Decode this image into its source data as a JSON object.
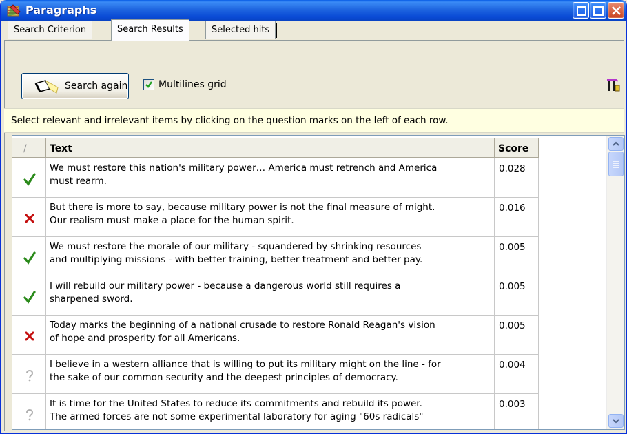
{
  "window": {
    "title": "Paragraphs",
    "icon": "paragraphs-app-icon",
    "controls": [
      "minimize-icon",
      "maximize-icon",
      "close-icon"
    ],
    "title_bar_color": "#0a4bd6"
  },
  "tabs": [
    {
      "label": "Search Criterion",
      "active": false
    },
    {
      "label": "Search Results",
      "active": true
    },
    {
      "label": "Selected hits",
      "active": false
    }
  ],
  "toolbar": {
    "search_again_label": "Search again",
    "search_icon": "flashlight-icon",
    "multilines_label": "Multilines grid",
    "multilines_checked": true,
    "right_icon": "run-icon"
  },
  "info_message": "Select relevant and irrelevant items by clicking on the question marks on the left of each row.",
  "grid": {
    "columns": {
      "mark": "/",
      "text": "Text",
      "score": "Score"
    },
    "rows": [
      {
        "mark": "relevant",
        "line1": "We must restore this nation's military power… America must retrench and America",
        "line2": "must rearm.",
        "score": "0.028"
      },
      {
        "mark": "irrelevant",
        "line1": "But there is more to say, because military power is not the final measure of might.",
        "line2": "Our realism must make a place for the human spirit.",
        "score": "0.016"
      },
      {
        "mark": "relevant",
        "line1": "We must restore the morale of our military - squandered by shrinking resources",
        "line2": "and multiplying missions - with better training, better treatment and better pay.",
        "score": "0.005"
      },
      {
        "mark": "relevant",
        "line1": "I will rebuild our military power - because a dangerous world still requires a",
        "line2": "sharpened sword.",
        "score": "0.005"
      },
      {
        "mark": "irrelevant",
        "line1": "Today marks the beginning of a national crusade to restore Ronald Reagan's vision",
        "line2": "of hope and prosperity for all Americans.",
        "score": "0.005"
      },
      {
        "mark": "unknown",
        "line1": "I believe in a western alliance that is willing to put its military might on the line - for",
        "line2": "the sake of our common security and the deepest principles of democracy.",
        "score": "0.004"
      },
      {
        "mark": "unknown",
        "line1": "It is time for the United States to reduce its commitments and rebuild its power.",
        "line2": "The armed forces are not some experimental laboratory for aging \"60s radicals\"",
        "score": "0.003"
      }
    ]
  },
  "colors": {
    "relevant": "#2a8a1a",
    "irrelevant": "#c41010",
    "unknown": "#b0b0b0",
    "info_bar": "#ffffe1"
  }
}
